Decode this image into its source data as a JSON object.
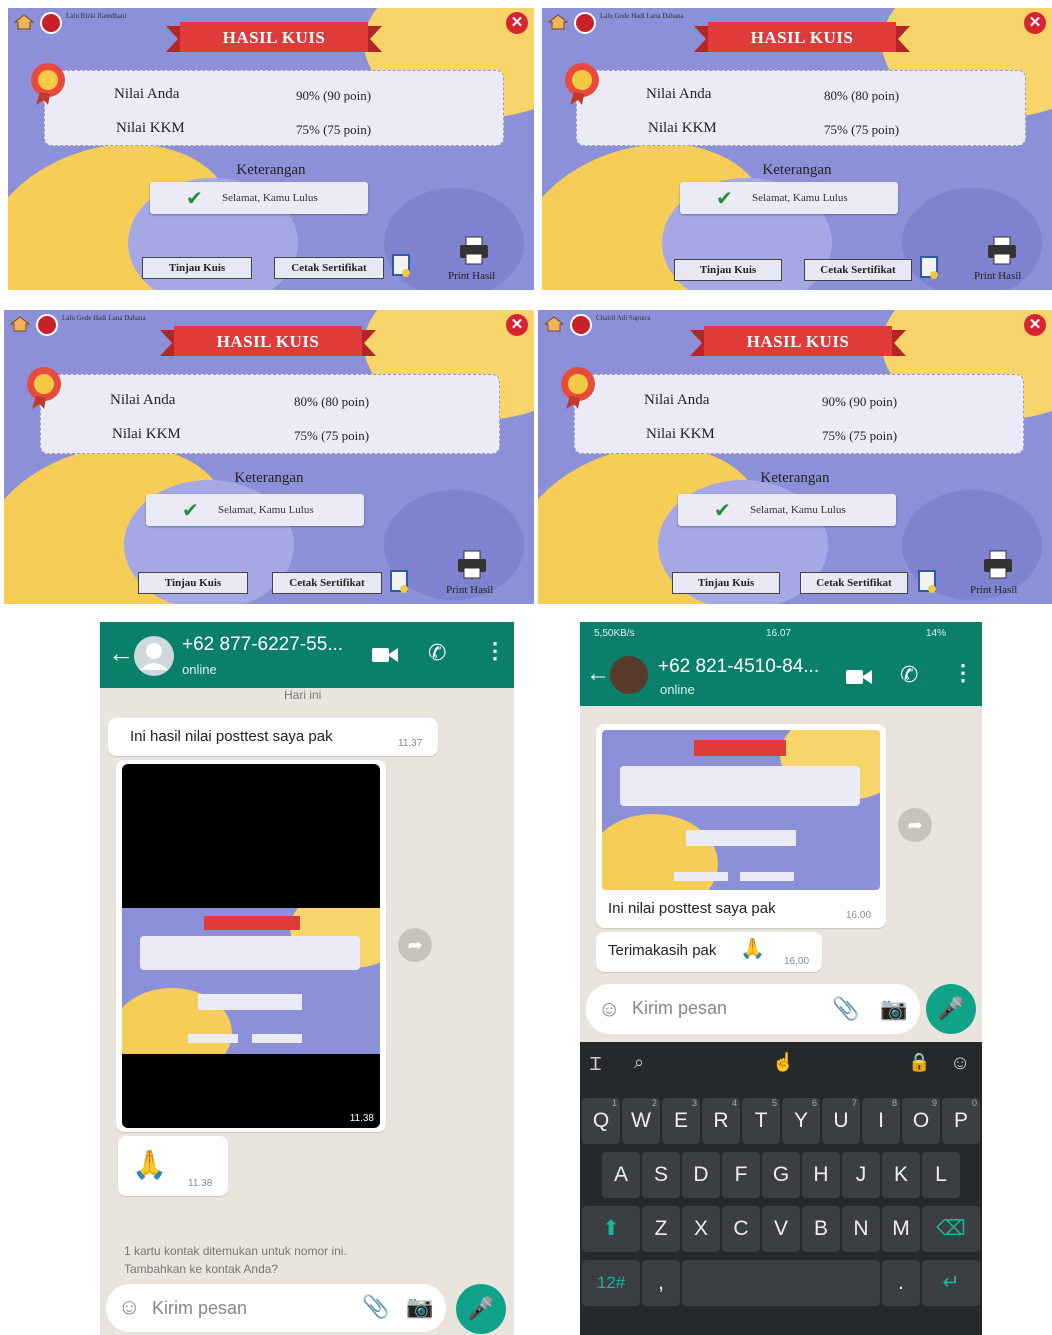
{
  "quiz": {
    "title": "HASIL KUIS",
    "label_score": "Nilai Anda",
    "label_kkm": "Nilai KKM",
    "kkm_value": "75% (75 poin)",
    "keterangan": "Keterangan",
    "status": "Selamat, Kamu Lulus",
    "btn_review": "Tinjau Kuis",
    "btn_certificate": "Cetak Sertifikat",
    "print_label": "Print Hasil",
    "panels": [
      {
        "user": "Lalu Rizki Ramdhani",
        "score": "90% (90 poin)"
      },
      {
        "user": "Lalu Gede Hadi Lana Dahana",
        "score": "80% (80 poin)"
      },
      {
        "user": "Lalu Gede Hadi Lana Dahana",
        "score": "80% (80 poin)"
      },
      {
        "user": "Chairil Adi Saputra",
        "score": "90% (90 poin)"
      }
    ]
  },
  "chat_left": {
    "contact": "+62 877-6227-55...",
    "status": "online",
    "day": "Hari ini",
    "msg1": "Ini hasil nilai posttest saya pak",
    "msg1_time": "11.37",
    "img_time": "11.38",
    "emoji_time": "11.38",
    "notice_line1": "1 kartu kontak ditemukan untuk nomor ini.",
    "notice_line2": "Tambahkan ke kontak Anda?",
    "input_placeholder": "Kirim pesan"
  },
  "chat_right": {
    "statusbar_left": "5,50KB/s",
    "statusbar_time": "16.07",
    "statusbar_battery": "14%",
    "contact": "+62 821-4510-84...",
    "status": "online",
    "msg1": "Ini nilai posttest saya pak",
    "msg1_time": "16.00",
    "msg2": "Terimakasih pak",
    "msg2_time": "16.00",
    "input_placeholder": "Kirim pesan",
    "keys_row1": [
      "Q",
      "W",
      "E",
      "R",
      "T",
      "Y",
      "U",
      "I",
      "O",
      "P"
    ],
    "keys_row1_hints": [
      "1",
      "2",
      "3",
      "4",
      "5",
      "6",
      "7",
      "8",
      "9",
      "0"
    ],
    "keys_row2": [
      "A",
      "S",
      "D",
      "F",
      "G",
      "H",
      "J",
      "K",
      "L"
    ],
    "keys_row3": [
      "Z",
      "X",
      "C",
      "V",
      "B",
      "N",
      "M"
    ],
    "key_num": "12#"
  },
  "colors": {
    "quiz_bg": "#8c90d8",
    "quiz_yellow": "#f5cd57",
    "ribbon_red": "#e03a3a",
    "whatsapp_green": "#0a7f6a",
    "chat_bg": "#e9e5de"
  }
}
